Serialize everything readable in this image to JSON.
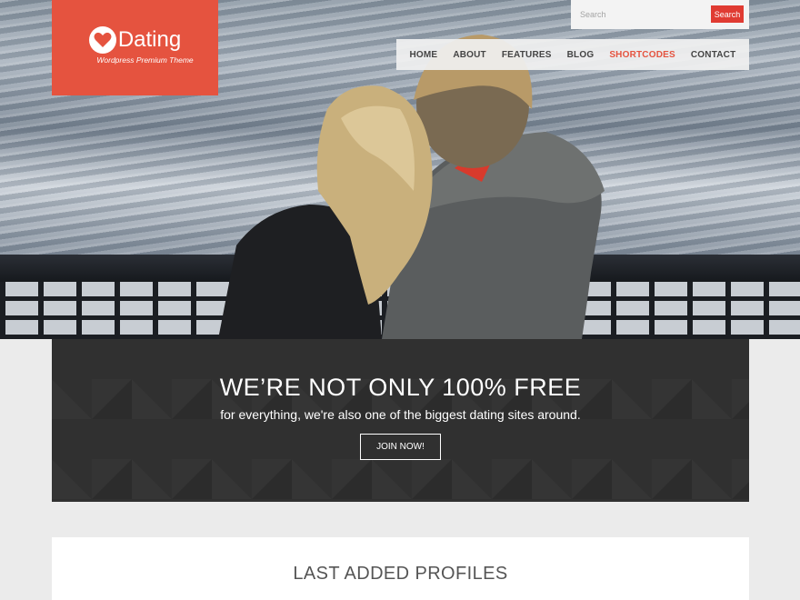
{
  "logo": {
    "name": "Dating",
    "tagline": "Wordpress Premium Theme",
    "color": "#e5533f"
  },
  "search": {
    "placeholder": "Search",
    "button_label": "Search"
  },
  "nav": {
    "items": [
      {
        "label": "HOME",
        "active": false
      },
      {
        "label": "ABOUT",
        "active": false
      },
      {
        "label": "FEATURES",
        "active": false
      },
      {
        "label": "BLOG",
        "active": false
      },
      {
        "label": "SHORTCODES",
        "active": true
      },
      {
        "label": "CONTACT",
        "active": false
      }
    ]
  },
  "hero": {
    "image": "couple-by-sea-photo"
  },
  "promo": {
    "title": "WE’RE NOT ONLY 100% FREE",
    "subtitle": "for everything, we're also one of the biggest dating sites around.",
    "button_label": "JOIN NOW!"
  },
  "profiles": {
    "title": "LAST ADDED PROFILES"
  },
  "colors": {
    "accent": "#e5533f",
    "search_button": "#e03b32",
    "promo_bg": "#303030"
  }
}
